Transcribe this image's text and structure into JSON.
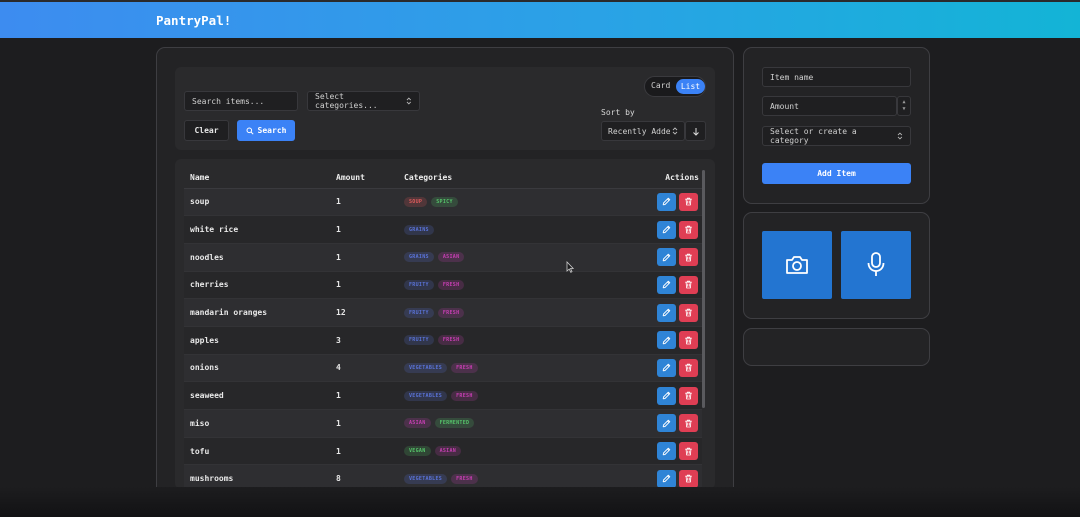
{
  "app": {
    "title": "PantryPal!"
  },
  "toolbar": {
    "search_placeholder": "Search items...",
    "categories_placeholder": "Select categories...",
    "clear_label": "Clear",
    "search_label": "Search",
    "sort_label": "Sort by",
    "sort_value": "Recently Added",
    "view_card": "Card",
    "view_list": "List",
    "selected_view": "List"
  },
  "table": {
    "headers": {
      "name": "Name",
      "amount": "Amount",
      "categories": "Categories",
      "actions": "Actions"
    },
    "rows": [
      {
        "name": "soup",
        "amount": "1",
        "categories": [
          {
            "label": "SOUP",
            "color": "#e05c5c"
          },
          {
            "label": "SPICY",
            "color": "#56c46a"
          }
        ]
      },
      {
        "name": "white rice",
        "amount": "1",
        "categories": [
          {
            "label": "GRAINS",
            "color": "#5a73d8"
          }
        ]
      },
      {
        "name": "noodles",
        "amount": "1",
        "categories": [
          {
            "label": "GRAINS",
            "color": "#5a73d8"
          },
          {
            "label": "ASIAN",
            "color": "#c83fb4"
          }
        ]
      },
      {
        "name": "cherries",
        "amount": "1",
        "categories": [
          {
            "label": "FRUITY",
            "color": "#5a73d8"
          },
          {
            "label": "FRESH",
            "color": "#c83fb4"
          }
        ]
      },
      {
        "name": "mandarin oranges",
        "amount": "12",
        "categories": [
          {
            "label": "FRUITY",
            "color": "#5a73d8"
          },
          {
            "label": "FRESH",
            "color": "#c83fb4"
          }
        ]
      },
      {
        "name": "apples",
        "amount": "3",
        "categories": [
          {
            "label": "FRUITY",
            "color": "#5a73d8"
          },
          {
            "label": "FRESH",
            "color": "#c83fb4"
          }
        ]
      },
      {
        "name": "onions",
        "amount": "4",
        "categories": [
          {
            "label": "VEGETABLES",
            "color": "#5a73d8"
          },
          {
            "label": "FRESH",
            "color": "#c83fb4"
          }
        ]
      },
      {
        "name": "seaweed",
        "amount": "1",
        "categories": [
          {
            "label": "VEGETABLES",
            "color": "#5a73d8"
          },
          {
            "label": "FRESH",
            "color": "#c83fb4"
          }
        ]
      },
      {
        "name": "miso",
        "amount": "1",
        "categories": [
          {
            "label": "ASIAN",
            "color": "#c83fb4"
          },
          {
            "label": "FERMENTED",
            "color": "#56c46a"
          }
        ]
      },
      {
        "name": "tofu",
        "amount": "1",
        "categories": [
          {
            "label": "VEGAN",
            "color": "#56c46a"
          },
          {
            "label": "ASIAN",
            "color": "#c83fb4"
          }
        ]
      },
      {
        "name": "mushrooms",
        "amount": "8",
        "categories": [
          {
            "label": "VEGETABLES",
            "color": "#5a73d8"
          },
          {
            "label": "FRESH",
            "color": "#c83fb4"
          }
        ]
      }
    ]
  },
  "form": {
    "item_name_placeholder": "Item name",
    "amount_placeholder": "Amount",
    "category_placeholder": "Select or create a category",
    "add_label": "Add Item"
  },
  "icons": {
    "search": "search-icon",
    "chevron": "chevron-updown-icon",
    "sort_direction": "arrow-down-icon",
    "edit": "pencil-icon",
    "delete": "trash-icon",
    "camera": "camera-icon",
    "microphone": "microphone-icon"
  },
  "colors": {
    "accent": "#3b82f6",
    "edit": "#2f84d6",
    "delete": "#df3e54",
    "media": "#2375d1"
  }
}
